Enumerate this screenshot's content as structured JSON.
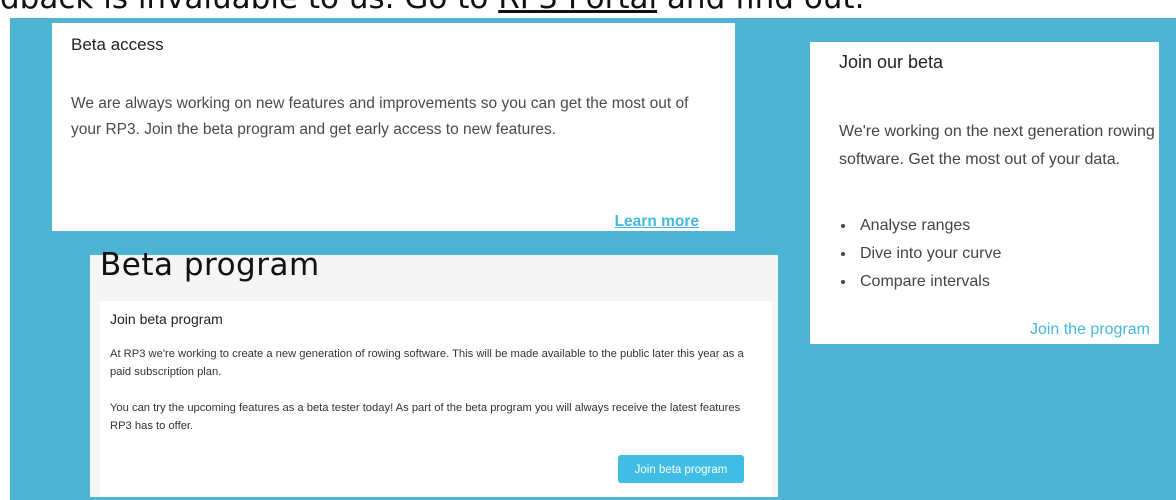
{
  "top_text": {
    "before": "dback is invaluable to us. Go to ",
    "link": "RP3 Portal",
    "after": " and find out."
  },
  "card1": {
    "title": "Beta access",
    "body": "We are always working on new features and improvements so you can get the most out of your RP3. Join the beta program and get early access to new features.",
    "link": "Learn more"
  },
  "card2": {
    "title": "Join our beta",
    "body": "We're working on the next generation rowing software. Get the most out of your data.",
    "bullets": [
      "Analyse ranges",
      "Dive into your curve",
      "Compare intervals"
    ],
    "link": "Join the program"
  },
  "card3": {
    "page_title": "Beta program",
    "title": "Join beta program",
    "paragraph1": "At RP3 we're working to create a new generation of rowing software. This will be made available to the public later this year as a paid subscription plan.",
    "paragraph2": "You can try the upcoming features as a beta tester today! As part of the beta program you will always receive the latest features RP3 has to offer.",
    "button": "Join beta program"
  },
  "colors": {
    "background": "#4db5d3",
    "accent": "#46b8dc",
    "button": "#3fbde4"
  }
}
